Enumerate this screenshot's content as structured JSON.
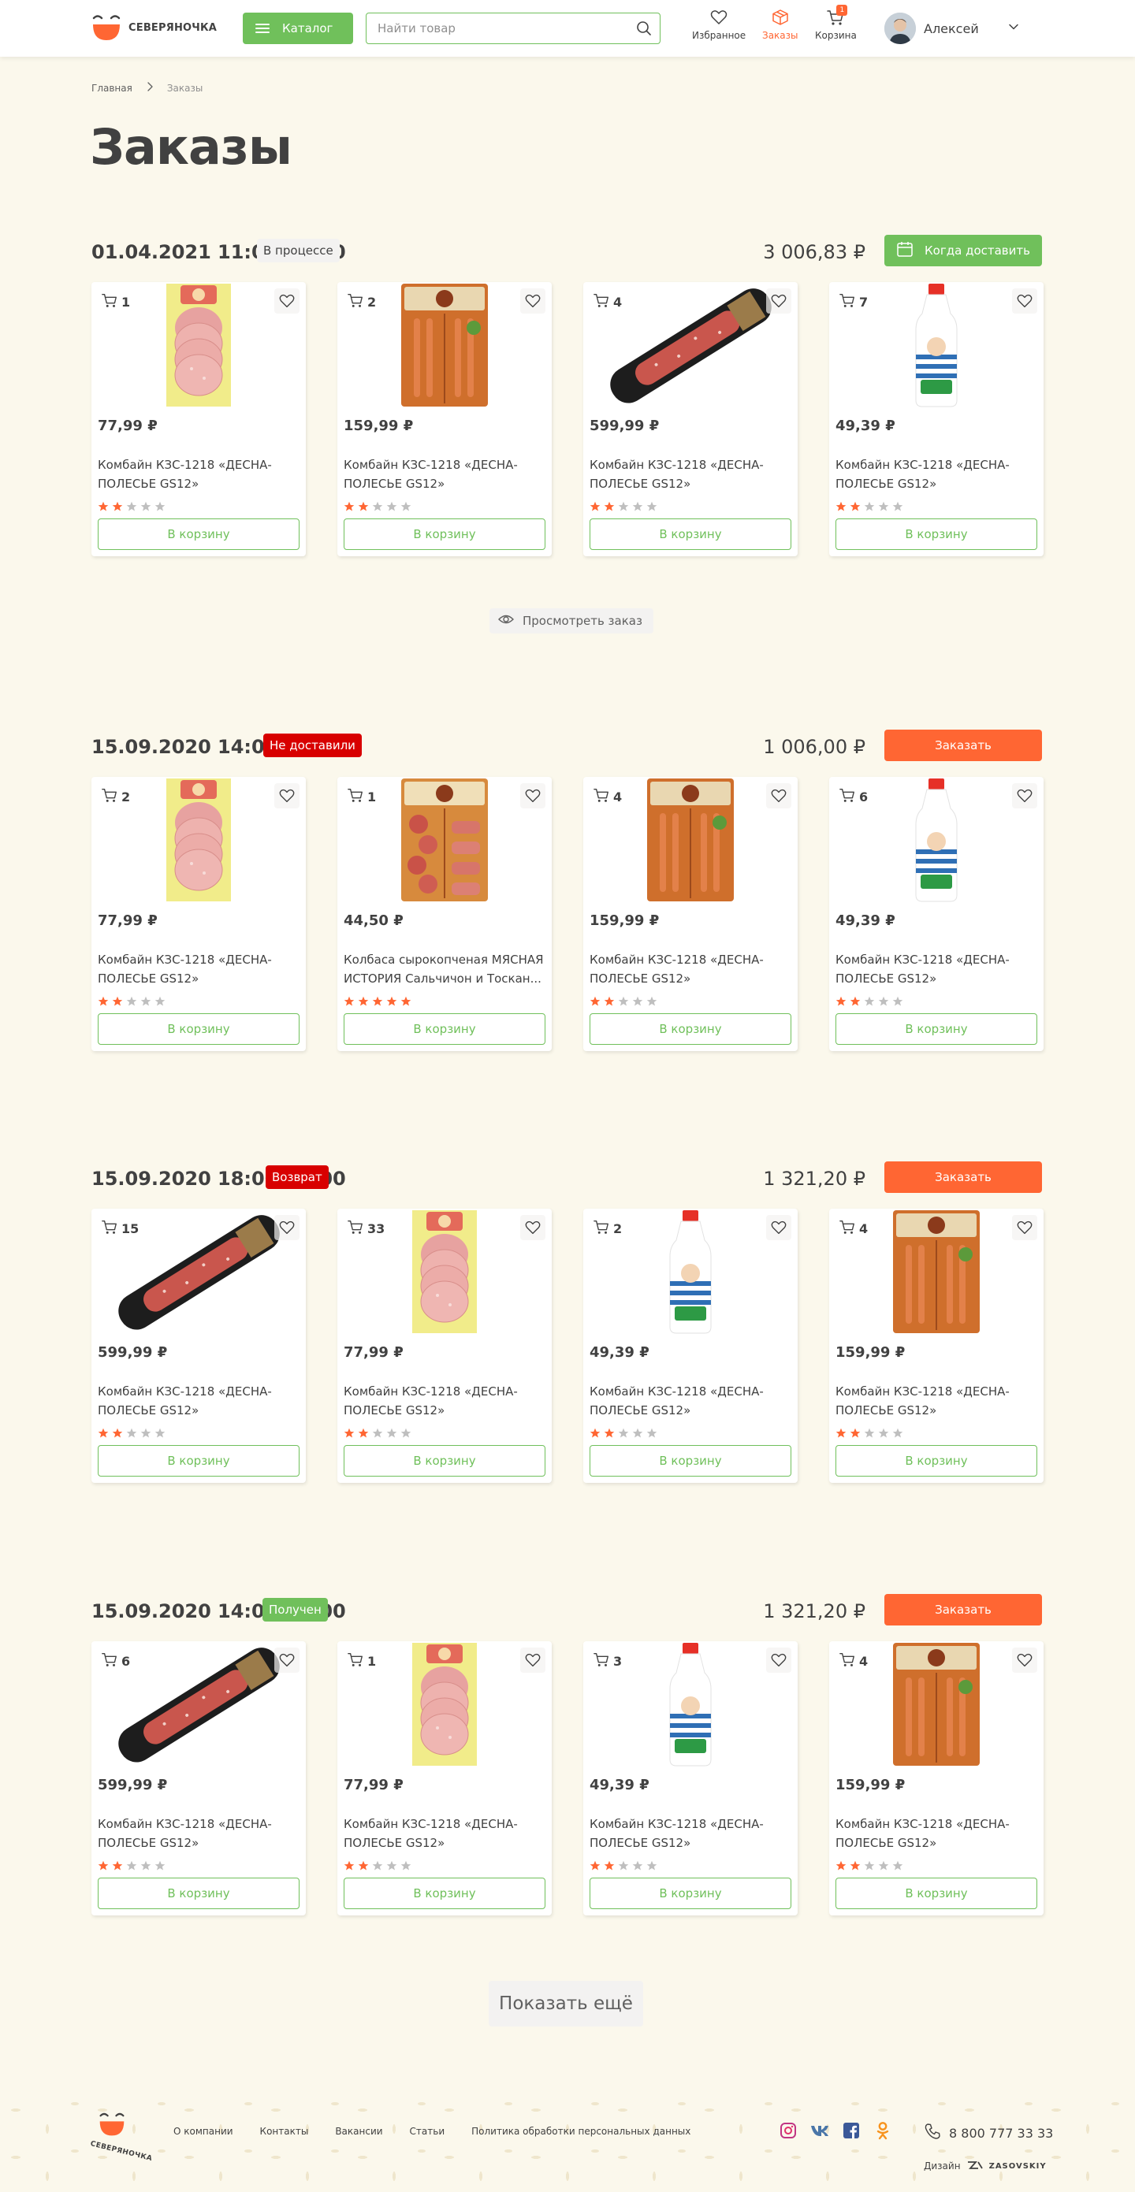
{
  "header": {
    "logo_text": "СЕВЕРЯНОЧКА",
    "catalog_label": "Каталог",
    "search_placeholder": "Найти товар",
    "nav": {
      "favorites": "Избранное",
      "orders": "Заказы",
      "cart": "Корзина",
      "cart_count": "1"
    },
    "user_name": "Алексей"
  },
  "breadcrumb": {
    "home": "Главная",
    "current": "Заказы"
  },
  "page_title": "Заказы",
  "add_to_cart_label": "В корзину",
  "view_order_label": "Просмотреть заказ",
  "show_more_label": "Показать ещё",
  "orders": [
    {
      "date": "01.04.2021",
      "time": "11:00-14:00",
      "status": "В процессе",
      "status_color": "#f3f2f1",
      "sum": "3 006,83 ₽",
      "action": "Когда доставить",
      "action_color": "#70c05b",
      "items": [
        {
          "qty": "1",
          "price": "77,99 ₽",
          "name": "Комбайн КЗС-1218 «ДЕСНА-ПОЛЕСЬЕ GS12»",
          "rating": 2,
          "image": "ham-pack"
        },
        {
          "qty": "2",
          "price": "159,99 ₽",
          "name": "Комбайн КЗС-1218 «ДЕСНА-ПОЛЕСЬЕ GS12»",
          "rating": 2,
          "image": "sausage-pack"
        },
        {
          "qty": "4",
          "price": "599,99 ₽",
          "name": "Комбайн КЗС-1218 «ДЕСНА-ПОЛЕСЬЕ GS12»",
          "rating": 2,
          "image": "salami-stick"
        },
        {
          "qty": "7",
          "price": "49,39 ₽",
          "name": "Комбайн КЗС-1218 «ДЕСНА-ПОЛЕСЬЕ GS12»",
          "rating": 2,
          "image": "milk-bottle"
        }
      ]
    },
    {
      "date": "15.09.2020",
      "time": "14:00-18:00",
      "status": "Не доставили",
      "status_color": "#d80000",
      "sum": "1 006,00 ₽",
      "action": "Заказать",
      "action_color": "#ff6633",
      "items": [
        {
          "qty": "2",
          "price": "77,99 ₽",
          "name": "Комбайн КЗС-1218 «ДЕСНА-ПОЛЕСЬЕ GS12»",
          "rating": 2,
          "image": "ham-pack"
        },
        {
          "qty": "1",
          "price": "44,50 ₽",
          "name": "Колбаса сырокопченая МЯСНАЯ ИСТОРИЯ Сальчичон и Тоскан...",
          "rating": 5,
          "image": "sliced-sausage-pack"
        },
        {
          "qty": "4",
          "price": "159,99 ₽",
          "name": "Комбайн КЗС-1218 «ДЕСНА-ПОЛЕСЬЕ GS12»",
          "rating": 2,
          "image": "sausage-pack"
        },
        {
          "qty": "6",
          "price": "49,39 ₽",
          "name": "Комбайн КЗС-1218 «ДЕСНА-ПОЛЕСЬЕ GS12»",
          "rating": 2,
          "image": "milk-bottle"
        }
      ]
    },
    {
      "date": "15.09.2020",
      "time": "18:00-20:00",
      "status": "Возврат",
      "status_color": "#d80000",
      "sum": "1 321,20 ₽",
      "action": "Заказать",
      "action_color": "#ff6633",
      "items": [
        {
          "qty": "15",
          "price": "599,99 ₽",
          "name": "Комбайн КЗС-1218 «ДЕСНА-ПОЛЕСЬЕ GS12»",
          "rating": 2,
          "image": "salami-stick"
        },
        {
          "qty": "33",
          "price": "77,99 ₽",
          "name": "Комбайн КЗС-1218 «ДЕСНА-ПОЛЕСЬЕ GS12»",
          "rating": 2,
          "image": "ham-pack"
        },
        {
          "qty": "2",
          "price": "49,39 ₽",
          "name": "Комбайн КЗС-1218 «ДЕСНА-ПОЛЕСЬЕ GS12»",
          "rating": 2,
          "image": "milk-bottle"
        },
        {
          "qty": "4",
          "price": "159,99 ₽",
          "name": "Комбайн КЗС-1218 «ДЕСНА-ПОЛЕСЬЕ GS12»",
          "rating": 2,
          "image": "sausage-pack"
        }
      ]
    },
    {
      "date": "15.09.2020",
      "time": "14:00-18:00",
      "status": "Получен",
      "status_color": "#70c05b",
      "sum": "1 321,20 ₽",
      "action": "Заказать",
      "action_color": "#ff6633",
      "items": [
        {
          "qty": "6",
          "price": "599,99 ₽",
          "name": "Комбайн КЗС-1218 «ДЕСНА-ПОЛЕСЬЕ GS12»",
          "rating": 2,
          "image": "salami-stick"
        },
        {
          "qty": "1",
          "price": "77,99 ₽",
          "name": "Комбайн КЗС-1218 «ДЕСНА-ПОЛЕСЬЕ GS12»",
          "rating": 2,
          "image": "ham-pack"
        },
        {
          "qty": "3",
          "price": "49,39 ₽",
          "name": "Комбайн КЗС-1218 «ДЕСНА-ПОЛЕСЬЕ GS12»",
          "rating": 2,
          "image": "milk-bottle"
        },
        {
          "qty": "4",
          "price": "159,99 ₽",
          "name": "Комбайн КЗС-1218 «ДЕСНА-ПОЛЕСЬЕ GS12»",
          "rating": 2,
          "image": "sausage-pack"
        }
      ]
    }
  ],
  "footer": {
    "logo_text": "СЕВЕРЯНОЧКА",
    "links": [
      "О компании",
      "Контакты",
      "Вакансии",
      "Статьи",
      "Политика обработки персональных данных"
    ],
    "socials": [
      "instagram-icon",
      "vk-icon",
      "facebook-icon",
      "odnoklassniki-icon"
    ],
    "phone": "8 800 777 33 33",
    "design_label": "Дизайн",
    "design_brand": "ZASOVSKIY"
  },
  "colors": {
    "accent_green": "#70c05b",
    "accent_orange": "#ff6633",
    "status_red": "#d80000",
    "background": "#fbf8ec"
  }
}
